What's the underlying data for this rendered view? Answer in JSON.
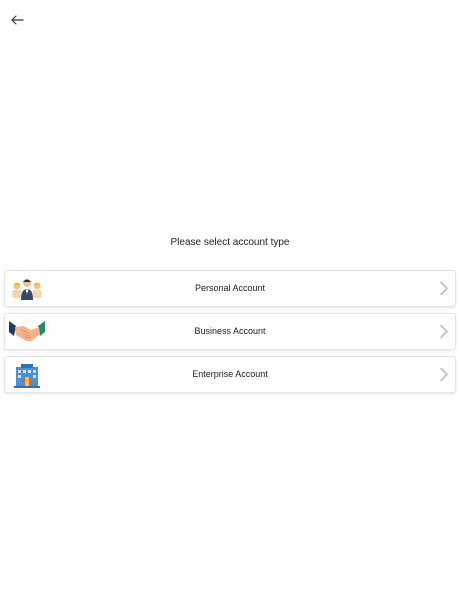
{
  "header": {
    "back_icon": "arrow-left-icon"
  },
  "main": {
    "prompt": "Please select account type",
    "options": [
      {
        "label": "Personal Account",
        "icon": "people-icon",
        "chevron": "chevron-right-icon"
      },
      {
        "label": "Business Account",
        "icon": "handshake-icon",
        "chevron": "chevron-right-icon"
      },
      {
        "label": "Enterprise Account",
        "icon": "office-building-icon",
        "chevron": "chevron-right-icon"
      }
    ]
  },
  "colors": {
    "chevron": "#bdbdbd",
    "card_border": "#e4e4e4",
    "text": "#222222"
  }
}
